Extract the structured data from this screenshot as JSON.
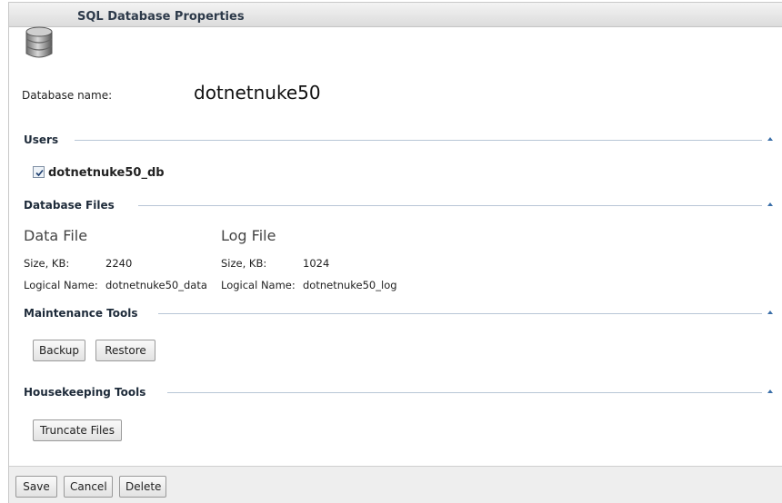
{
  "window": {
    "title": "SQL Database Properties"
  },
  "database": {
    "name_label": "Database name:",
    "name_value": "dotnetnuke50"
  },
  "users": {
    "section_title": "Users",
    "items": [
      {
        "label": "dotnetnuke50_db",
        "checked": true
      }
    ]
  },
  "files": {
    "section_title": "Database Files",
    "data_file": {
      "title": "Data File",
      "size_label": "Size, KB:",
      "size_value": "2240",
      "logical_label": "Logical Name:",
      "logical_value": "dotnetnuke50_data"
    },
    "log_file": {
      "title": "Log File",
      "size_label": "Size, KB:",
      "size_value": "1024",
      "logical_label": "Logical Name:",
      "logical_value": "dotnetnuke50_log"
    }
  },
  "maintenance": {
    "section_title": "Maintenance Tools",
    "backup_label": "Backup",
    "restore_label": "Restore"
  },
  "housekeeping": {
    "section_title": "Housekeeping Tools",
    "truncate_label": "Truncate Files"
  },
  "footer": {
    "save_label": "Save",
    "cancel_label": "Cancel",
    "delete_label": "Delete"
  },
  "icons": {
    "database": "database-icon",
    "collapse": "chevron-up-icon",
    "check": "check-icon"
  },
  "colors": {
    "section_rule": "#b8c6d6",
    "title_text": "#2d3a4a",
    "collapse_arrow": "#3a6ea8"
  }
}
